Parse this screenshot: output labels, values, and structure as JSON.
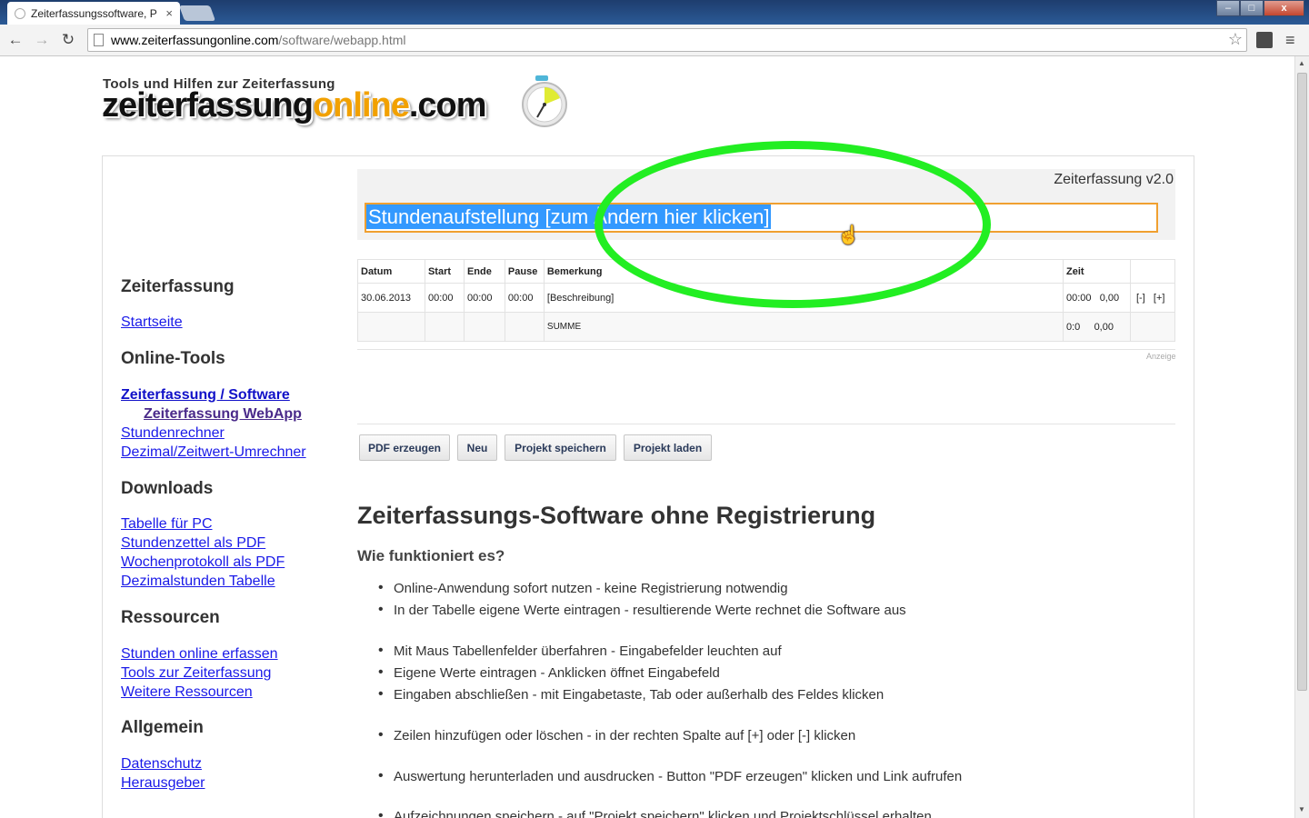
{
  "browser": {
    "tab_title": "Zeiterfassungssoftware, P",
    "tab_close": "×",
    "url_host": "www.zeiterfassungonline.com",
    "url_path": "/software/webapp.html",
    "back": "←",
    "forward": "→",
    "reload": "↻",
    "star": "☆",
    "menu": "≡",
    "win_min": "–",
    "win_max": "□",
    "win_close": "x"
  },
  "header": {
    "tagline": "Tools und Hilfen zur Zeiterfassung",
    "logo_part1": "zeiterfassung",
    "logo_part2": "online",
    "logo_part3": ".com"
  },
  "sidebar": {
    "sections": [
      {
        "heading": "Zeiterfassung",
        "links": [
          "Startseite"
        ]
      },
      {
        "heading": "Online-Tools",
        "links": [
          "Zeiterfassung / Software",
          "Zeiterfassung WebApp",
          "Stundenrechner",
          "Dezimal/Zeitwert-Umrechner"
        ]
      },
      {
        "heading": "Downloads",
        "links": [
          "Tabelle für PC",
          "Stundenzettel als PDF",
          "Wochenprotokoll als PDF",
          "Dezimalstunden Tabelle"
        ]
      },
      {
        "heading": "Ressourcen",
        "links": [
          "Stunden online erfassen",
          "Tools zur Zeiterfassung",
          "Weitere Ressourcen"
        ]
      },
      {
        "heading": "Allgemein",
        "links": [
          "Datenschutz",
          "Herausgeber"
        ]
      }
    ]
  },
  "app": {
    "version": "Zeiterfassung v2.0",
    "title": "Stundenaufstellung [zum Ändern hier klicken]",
    "table": {
      "headers": [
        "Datum",
        "Start",
        "Ende",
        "Pause",
        "Bemerkung",
        "Zeit",
        ""
      ],
      "row": {
        "datum": "30.06.2013",
        "start": "00:00",
        "ende": "00:00",
        "pause": "00:00",
        "bemerkung": "[Beschreibung]",
        "zeit": "00:00",
        "dezimal": "0,00",
        "remove": "[-]",
        "add": "[+]"
      },
      "sum": {
        "label": "SUMME",
        "zeit": "0:0",
        "dezimal": "0,00"
      }
    },
    "ad_label": "Anzeige",
    "buttons": [
      "PDF erzeugen",
      "Neu",
      "Projekt speichern",
      "Projekt laden"
    ]
  },
  "article": {
    "title": "Zeiterfassungs-Software ohne Registrierung",
    "subtitle": "Wie funktioniert es?",
    "bullets": [
      "Online-Anwendung sofort nutzen - keine Registrierung notwendig",
      "In der Tabelle eigene Werte eintragen - resultierende Werte rechnet die Software aus",
      "Mit Maus Tabellenfelder überfahren - Eingabefelder leuchten auf",
      "Eigene Werte eintragen - Anklicken öffnet Eingabefeld",
      "Eingaben abschließen - mit Eingabetaste, Tab oder außerhalb des Feldes klicken",
      "Zeilen hinzufügen oder löschen - in der rechten Spalte auf [+] oder [-] klicken",
      "Auswertung herunterladen und ausdrucken - Button \"PDF erzeugen\" klicken und Link aufrufen",
      "Aufzeichnungen speichern - auf \"Projekt speichern\" klicken und Projektschlüssel erhalten"
    ]
  },
  "colors": {
    "highlight": "#22ee22",
    "selection": "#3399ff",
    "input_border": "#f0a030"
  }
}
